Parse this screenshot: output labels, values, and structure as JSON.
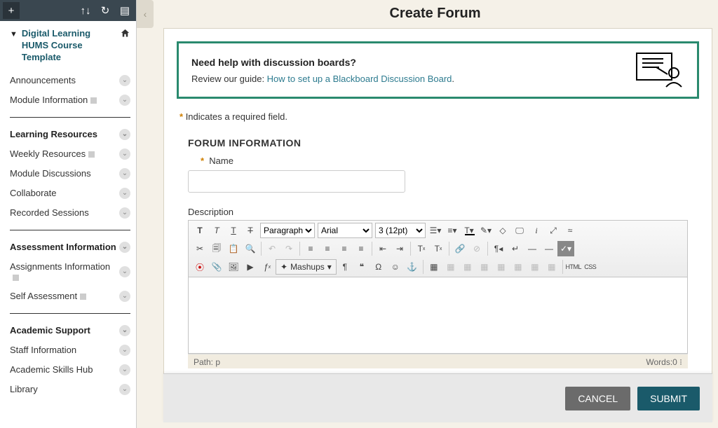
{
  "sidebar": {
    "course_title": "Digital Learning HUMS Course Template",
    "groups": [
      {
        "items": [
          {
            "label": "Announcements"
          },
          {
            "label": "Module Information",
            "badge": true
          }
        ]
      },
      {
        "header": "Learning Resources",
        "items": [
          {
            "label": "Weekly Resources",
            "badge": true
          },
          {
            "label": "Module Discussions"
          },
          {
            "label": "Collaborate"
          },
          {
            "label": "Recorded Sessions"
          }
        ]
      },
      {
        "header": "Assessment Information",
        "items": [
          {
            "label": "Assignments Information",
            "badge": true
          },
          {
            "label": "Self Assessment",
            "badge": true
          }
        ]
      },
      {
        "header": "Academic Support",
        "items": [
          {
            "label": "Staff Information"
          },
          {
            "label": "Academic Skills Hub"
          },
          {
            "label": "Library"
          }
        ]
      }
    ]
  },
  "page": {
    "title": "Create Forum"
  },
  "help": {
    "title": "Need help with discussion boards?",
    "review_prefix": "Review our guide: ",
    "link_text": "How to set up a Blackboard Discussion Board",
    "period": "."
  },
  "required_note": "Indicates a required field.",
  "section": {
    "header": "FORUM INFORMATION",
    "name_label": "Name",
    "description_label": "Description"
  },
  "editor": {
    "para": "Paragraph",
    "font": "Arial",
    "size": "3 (12pt)",
    "mashups": "Mashups",
    "html": "HTML",
    "css": "CSS",
    "path_label": "Path: ",
    "path_value": "p",
    "words_label": "Words:",
    "words_value": "0"
  },
  "footer": {
    "cancel": "CANCEL",
    "submit": "SUBMIT"
  }
}
